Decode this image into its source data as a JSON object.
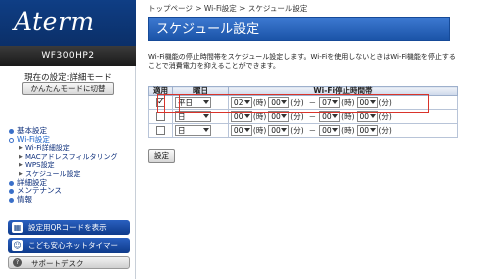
{
  "sidebar": {
    "logo": "Aterm",
    "model": "WF300HP2",
    "current_mode": "現在の設定:詳細モード",
    "mode_button": "かんたんモードに切替",
    "nav": [
      {
        "label": "基本設定",
        "level": 1
      },
      {
        "label": "Wi-Fi設定",
        "level": 1,
        "active": true
      },
      {
        "label": "Wi-Fi詳細設定",
        "level": 2
      },
      {
        "label": "MACアドレスフィルタリング",
        "level": 2
      },
      {
        "label": "WPS設定",
        "level": 2
      },
      {
        "label": "スケジュール設定",
        "level": 2
      },
      {
        "label": "詳細設定",
        "level": 1
      },
      {
        "label": "メンテナンス",
        "level": 1
      },
      {
        "label": "情報",
        "level": 1
      }
    ],
    "qr_button": "設定用QRコードを表示",
    "kids_button": "こども安心ネットタイマー",
    "support_button": "サポートデスク"
  },
  "breadcrumb": "トップページ > Wi-Fi設定 > スケジュール設定",
  "title": "スケジュール設定",
  "description": "Wi-Fi機能の停止時間帯をスケジュール設定します。Wi-Fiを使用しないときはWi-Fi機能を停止することで消費電力を抑えることができます。",
  "table": {
    "headers": {
      "apply": "適用",
      "day": "曜日",
      "stop_time": "Wi-Fi停止時間帯"
    },
    "units": {
      "hour": "(時)",
      "minute": "(分)",
      "dash": "－"
    },
    "rows": [
      {
        "checked": true,
        "day": "平日",
        "start_h": "02",
        "start_m": "00",
        "end_h": "07",
        "end_m": "00"
      },
      {
        "checked": false,
        "day": "日",
        "start_h": "00",
        "start_m": "00",
        "end_h": "00",
        "end_m": "00"
      },
      {
        "checked": false,
        "day": "日",
        "start_h": "00",
        "start_m": "00",
        "end_h": "00",
        "end_m": "00"
      }
    ]
  },
  "set_button": "設定",
  "colors": {
    "brand": "#0f3e85",
    "title_bar": "#1b54a8",
    "highlight": "#d9342b"
  }
}
